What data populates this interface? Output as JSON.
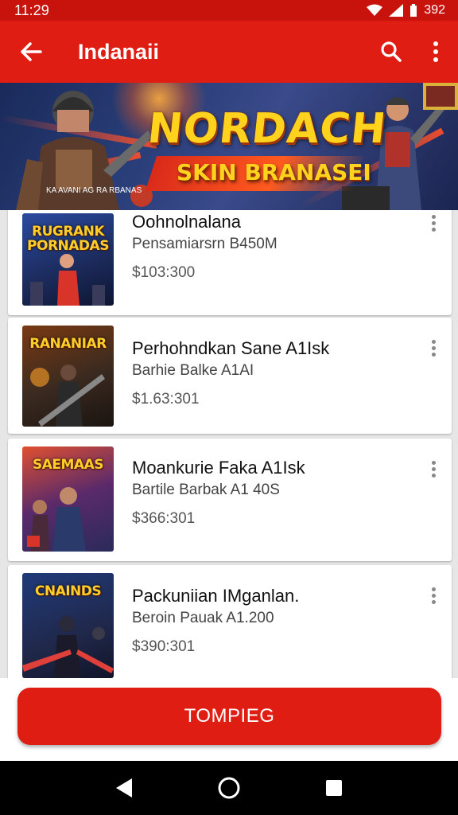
{
  "status_bar": {
    "time": "11:29",
    "battery": "392"
  },
  "app_bar": {
    "title": "Indanaii"
  },
  "banner": {
    "title": "NORDACH",
    "subtitle": "SKIN BRANASEI",
    "fineprint": "KA AVANI AG RA RBANAS"
  },
  "items": [
    {
      "thumb_title": "RUGRANK PORNADAS",
      "name": "Oohnolnalana",
      "subtitle": "Pensamiarsrn B450M",
      "price": "$103:300",
      "colors": [
        "#2b4aa0",
        "#d8342a",
        "#1b2a5a"
      ]
    },
    {
      "thumb_title": "RANANIAR",
      "name": "Perhohndkan Sane A1Isk",
      "subtitle": "Barhie Balke A1AI",
      "price": "$1.63:301",
      "colors": [
        "#3a2a20",
        "#e89a20",
        "#7a3a12"
      ]
    },
    {
      "thumb_title": "SAEMAAS",
      "name": "Moankurie Faka A1Isk",
      "subtitle": "Bartile Barbak A1 40S",
      "price": "$366:301",
      "colors": [
        "#5a2a6a",
        "#e05030",
        "#2a2a5a"
      ]
    },
    {
      "thumb_title": "CNAINDS",
      "name": "Packuniian IMganlan.",
      "subtitle": "Beroin Pauak A1.200",
      "price": "$390:301",
      "colors": [
        "#1f3a7a",
        "#e0403a",
        "#20284a"
      ]
    }
  ],
  "action_button": {
    "label": "TOMPIEG"
  },
  "accent": "#df1d13"
}
